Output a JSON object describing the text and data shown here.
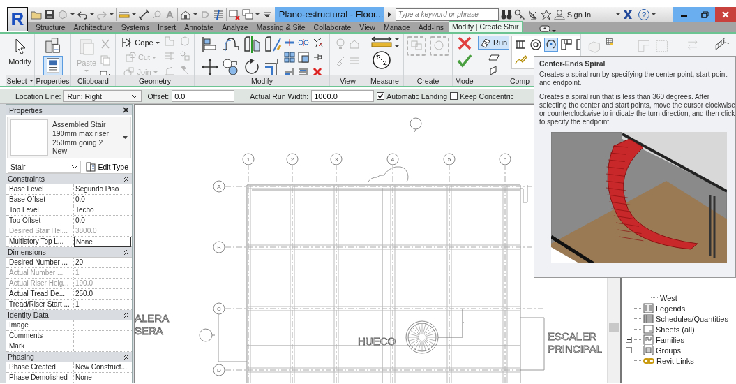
{
  "app_button": {
    "logo": "R"
  },
  "title_bar": {
    "text_tool": "A",
    "title": "Plano-estructural - Floor...",
    "search": {
      "placeholder": "Type a keyword or phrase"
    },
    "sign_in": "Sign In",
    "help": "?"
  },
  "ribbon_tabs": [
    {
      "label": "Structure",
      "selected": false
    },
    {
      "label": "Architecture",
      "selected": false
    },
    {
      "label": "Systems",
      "selected": false
    },
    {
      "label": "Insert",
      "selected": false
    },
    {
      "label": "Annotate",
      "selected": false
    },
    {
      "label": "Analyze",
      "selected": false
    },
    {
      "label": "Massing & Site",
      "selected": false
    },
    {
      "label": "Collaborate",
      "selected": false
    },
    {
      "label": "View",
      "selected": false
    },
    {
      "label": "Manage",
      "selected": false
    },
    {
      "label": "Add-Ins",
      "selected": false
    },
    {
      "label": "Modify | Create Stair",
      "selected": true
    }
  ],
  "ribbon_panels": [
    {
      "kind": "select",
      "title": "Select",
      "dropdown": true,
      "buttons": [
        {
          "label": "Modify",
          "disabled": false
        }
      ]
    },
    {
      "kind": "properties",
      "title": "Properties",
      "dropdown": false,
      "toggles": [
        {
          "kind": "type-properties",
          "on": false
        },
        {
          "kind": "properties",
          "on": true
        }
      ]
    },
    {
      "kind": "clipboard",
      "title": "Clipboard",
      "dropdown": false,
      "buttons": [
        {
          "label": "Paste",
          "disabled": true
        }
      ]
    },
    {
      "kind": "geometry",
      "title": "Geometry",
      "dropdown": false,
      "buttons": [
        {
          "label": "Cope",
          "disabled": false
        },
        {
          "label": "Cut",
          "disabled": true
        },
        {
          "label": "Join",
          "disabled": true
        }
      ]
    },
    {
      "kind": "modify",
      "title": "Modify",
      "dropdown": false
    },
    {
      "kind": "view",
      "title": "View",
      "dropdown": false
    },
    {
      "kind": "measure",
      "title": "Measure",
      "dropdown": false
    },
    {
      "kind": "create",
      "title": "Create",
      "dropdown": false
    },
    {
      "kind": "mode",
      "title": "Mode",
      "dropdown": false
    },
    {
      "kind": "component",
      "title": "Comp",
      "dropdown": false,
      "buttons": [
        {
          "label": "Run",
          "selected": true
        }
      ],
      "tools": [
        {
          "kind": "railing",
          "selected": false
        },
        {
          "kind": "full-spiral",
          "selected": false
        },
        {
          "kind": "center-ends-spiral",
          "selected": true
        },
        {
          "kind": "l-winder",
          "selected": false
        },
        {
          "kind": "u-winder",
          "selected": false
        },
        {
          "kind": "sketch",
          "selected": false
        }
      ]
    }
  ],
  "options_bar": {
    "location_line": {
      "label": "Location Line:",
      "value": "Run: Right"
    },
    "offset": {
      "label": "Offset:",
      "value": "0.0"
    },
    "run_width": {
      "label": "Actual Run Width:",
      "value": "1000.0"
    },
    "checkboxes": [
      {
        "label": "Automatic Landing",
        "checked": true
      },
      {
        "label": "Keep Concentric",
        "checked": false
      }
    ]
  },
  "properties": {
    "title": "Properties",
    "type_lines": [
      "Assembled Stair",
      "190mm max riser",
      "250mm going 2 New"
    ],
    "filter": "Stair",
    "edit_type": "Edit Type",
    "groups": [
      {
        "name": "Constraints",
        "expanded": true,
        "rows": [
          {
            "name": "Base Level",
            "value": "Segundo Piso",
            "disabled": false,
            "editing": false
          },
          {
            "name": "Base Offset",
            "value": "0.0",
            "disabled": false,
            "editing": false
          },
          {
            "name": "Top Level",
            "value": "Techo",
            "disabled": false,
            "editing": false
          },
          {
            "name": "Top Offset",
            "value": "0.0",
            "disabled": false,
            "editing": false
          },
          {
            "name": "Desired Stair Hei...",
            "value": "3800.0",
            "disabled": true,
            "editing": false
          },
          {
            "name": "Multistory Top L...",
            "value": "None",
            "disabled": false,
            "editing": true
          }
        ]
      },
      {
        "name": "Dimensions",
        "expanded": true,
        "rows": [
          {
            "name": "Desired Number ...",
            "value": "20",
            "disabled": false,
            "editing": false
          },
          {
            "name": "Actual Number ...",
            "value": "1",
            "disabled": true,
            "editing": false
          },
          {
            "name": "Actual Riser Heig...",
            "value": "190.0",
            "disabled": true,
            "editing": false
          },
          {
            "name": "Actual Tread De...",
            "value": "250.0",
            "disabled": false,
            "editing": false
          },
          {
            "name": "Tread/Riser Start ...",
            "value": "1",
            "disabled": false,
            "editing": false
          }
        ]
      },
      {
        "name": "Identity Data",
        "expanded": true,
        "rows": [
          {
            "name": "Image",
            "disabled": false,
            "editing": false
          },
          {
            "name": "Comments",
            "disabled": false,
            "editing": false
          },
          {
            "name": "Mark",
            "disabled": false,
            "editing": false
          }
        ]
      },
      {
        "name": "Phasing",
        "expanded": true,
        "rows": [
          {
            "name": "Phase Created",
            "value": "New Construct...",
            "disabled": false,
            "editing": false
          },
          {
            "name": "Phase Demolished",
            "value": "None",
            "disabled": false,
            "editing": false
          }
        ]
      }
    ]
  },
  "drawing": {
    "grid_columns": [
      "1",
      "2",
      "3",
      "4",
      "5",
      "6"
    ],
    "grid_rows": [
      "A",
      "B",
      "C",
      "D"
    ],
    "labels": [
      {
        "text": "ALERA"
      },
      {
        "text": "SERA"
      },
      {
        "text": "HUECO"
      },
      {
        "text": "ESCALER"
      },
      {
        "text": "PRINCIPAL"
      }
    ]
  },
  "project_browser": {
    "continued_children": [
      {
        "label": "West"
      }
    ],
    "items": [
      {
        "kind": "legends",
        "label": "Legends",
        "expandable": false
      },
      {
        "kind": "schedules",
        "label": "Schedules/Quantities",
        "expandable": false
      },
      {
        "kind": "sheets",
        "label": "Sheets (all)",
        "expandable": false
      },
      {
        "kind": "families",
        "label": "Families",
        "expandable": true
      },
      {
        "kind": "groups",
        "label": "Groups",
        "expandable": true
      },
      {
        "kind": "links",
        "label": "Revit Links",
        "expandable": false
      }
    ]
  },
  "tooltip": {
    "title": "Center-Ends Spiral",
    "paragraphs": [
      "Creates a spiral run by specifying the center point, start point, and endpoint.",
      "Creates a spiral run that is less than 360 degrees. After selecting the center and start points, move the cursor clockwise or counterclockwise to indicate the turn direction, and then click to specify the endpoint."
    ]
  }
}
